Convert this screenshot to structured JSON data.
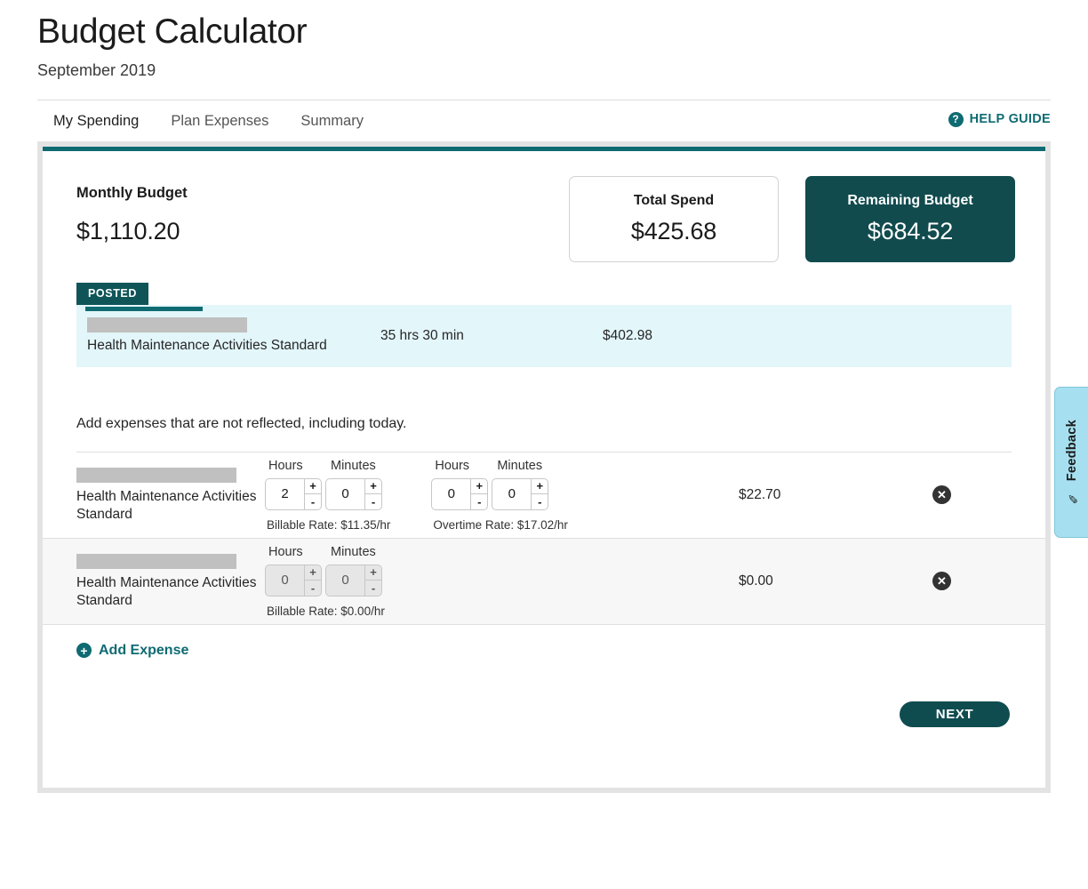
{
  "header": {
    "title": "Budget Calculator",
    "subtitle": "September 2019"
  },
  "tabs": [
    {
      "label": "My Spending",
      "active": true
    },
    {
      "label": "Plan Expenses",
      "active": false
    },
    {
      "label": "Summary",
      "active": false
    }
  ],
  "help_guide": {
    "label": "HELP GUIDE",
    "icon": "question-circle-icon"
  },
  "summary": {
    "monthly_budget_label": "Monthly Budget",
    "monthly_budget_value": "$1,110.20",
    "total_spend_label": "Total Spend",
    "total_spend_value": "$425.68",
    "remaining_label": "Remaining Budget",
    "remaining_value": "$684.52"
  },
  "posted": {
    "badge": "POSTED",
    "name": "Health Maintenance Activities Standard",
    "time": "35 hrs 30 min",
    "amount": "$402.98"
  },
  "note": "Add expenses that are not reflected, including today.",
  "expense_rows": [
    {
      "name": "Health Maintenance Activities Standard",
      "billable": {
        "hours_label": "Hours",
        "minutes_label": "Minutes",
        "hours_value": "2",
        "minutes_value": "0",
        "rate": "Billable Rate: $11.35/hr"
      },
      "overtime": {
        "hours_label": "Hours",
        "minutes_label": "Minutes",
        "hours_value": "0",
        "minutes_value": "0",
        "rate": "Overtime Rate: $17.02/hr"
      },
      "amount": "$22.70",
      "disabled": false
    },
    {
      "name": "Health Maintenance Activities Standard",
      "billable": {
        "hours_label": "Hours",
        "minutes_label": "Minutes",
        "hours_value": "0",
        "minutes_value": "0",
        "rate": "Billable Rate: $0.00/hr"
      },
      "amount": "$0.00",
      "disabled": true
    }
  ],
  "stepper": {
    "increment": "+",
    "decrement": "-"
  },
  "remove_label": "✕",
  "add_expense": {
    "label": "Add Expense",
    "icon": "plus-circle-icon"
  },
  "next_button": "NEXT",
  "feedback": {
    "label": "Feedback",
    "icon": "feedback-pencil-icon"
  },
  "colors": {
    "teal": "#0f6b72",
    "dark_teal": "#114b4e",
    "posted_bg": "#e3f6fa",
    "badge": "#0f5558",
    "feedback_bg": "#a6e0f0"
  }
}
